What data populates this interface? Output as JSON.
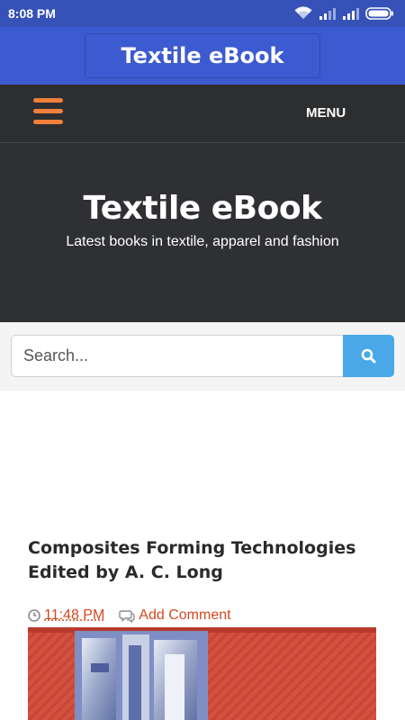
{
  "status_bar": {
    "time": "8:08 PM"
  },
  "app_bar": {
    "title": "Textile eBook"
  },
  "nav": {
    "menu_label": "MENU"
  },
  "hero": {
    "title": "Textile eBook",
    "subtitle": "Latest books in textile, apparel and fashion"
  },
  "search": {
    "placeholder": "Search..."
  },
  "post": {
    "title": "Composites Forming Technologies Edited by A. C. Long",
    "time": "11:48 PM",
    "comment_label": "Add Comment"
  },
  "colors": {
    "status_bar": "#3652b8",
    "app_bar": "#3d5bd0",
    "nav_bg": "#2d2e30",
    "hamburger": "#f0803a",
    "search_button": "#4aa8e8",
    "meta_accent": "#d2481f"
  },
  "icons": {
    "hamburger": "menu-icon",
    "search": "search-icon",
    "clock": "clock-icon",
    "comment": "comment-icon"
  }
}
